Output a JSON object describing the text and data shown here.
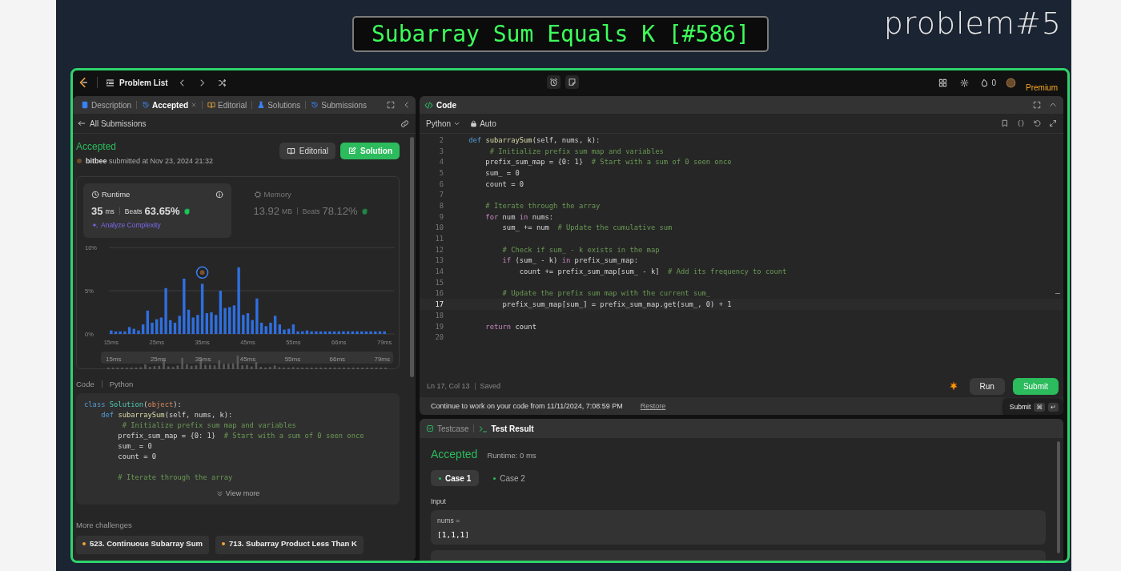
{
  "banner": {
    "title": "Subarray Sum Equals K [#586]",
    "label": "problem#5"
  },
  "topbar": {
    "problem_list": "Problem List",
    "streak": "0",
    "premium": "Premium"
  },
  "left": {
    "tabs": [
      {
        "label": "Description",
        "selected": false,
        "closable": false
      },
      {
        "label": "Accepted",
        "selected": true,
        "closable": true
      },
      {
        "label": "Editorial",
        "selected": false,
        "closable": false
      },
      {
        "label": "Solutions",
        "selected": false,
        "closable": false
      },
      {
        "label": "Submissions",
        "selected": false,
        "closable": false
      }
    ],
    "back_link": "All Submissions",
    "status": "Accepted",
    "user": "bitbee",
    "submitted": "submitted at Nov 23, 2024 21:32",
    "buttons": [
      {
        "label": "Editorial",
        "kind": "secondary"
      },
      {
        "label": "Solution",
        "kind": "primary"
      }
    ],
    "stats": [
      {
        "title": "Runtime",
        "value": "35",
        "unit": "ms",
        "beats_label": "Beats",
        "beats": "63.65%",
        "selected": true,
        "link": "Analyze Complexity"
      },
      {
        "title": "Memory",
        "value": "13.92",
        "unit": "MB",
        "beats_label": "Beats",
        "beats": "78.12%",
        "selected": false
      }
    ],
    "chart_data": {
      "type": "bar",
      "ylim": [
        0,
        10
      ],
      "yticks": [
        {
          "value": 0,
          "label": "0%"
        },
        {
          "value": 5,
          "label": "5%"
        },
        {
          "value": 10,
          "label": "10%"
        }
      ],
      "categories": [
        "15ms",
        null,
        null,
        null,
        null,
        null,
        null,
        null,
        null,
        null,
        "25ms",
        null,
        null,
        null,
        null,
        null,
        null,
        null,
        null,
        null,
        "35ms",
        null,
        null,
        null,
        null,
        null,
        null,
        null,
        null,
        null,
        "45ms",
        null,
        null,
        null,
        null,
        null,
        null,
        null,
        null,
        null,
        "55ms",
        null,
        null,
        null,
        null,
        null,
        null,
        null,
        null,
        null,
        "66ms",
        null,
        null,
        null,
        null,
        null,
        null,
        null,
        null,
        null,
        "79ms"
      ],
      "values": [
        0.4,
        0.3,
        0.3,
        0.3,
        0.8,
        0.6,
        0.4,
        1.1,
        2.7,
        1.3,
        1.7,
        1.9,
        5.3,
        1.6,
        1.3,
        2.1,
        6.4,
        2.8,
        1.9,
        2.2,
        5.8,
        2.4,
        2.5,
        2.2,
        5.0,
        3.0,
        3.1,
        3.3,
        7.7,
        2.2,
        2.4,
        1.6,
        4.1,
        1.3,
        0.9,
        1.3,
        2.1,
        1.1,
        0.5,
        0.6,
        1.1,
        0.3,
        0.3,
        0.4,
        0.3,
        0.3,
        0.3,
        0.3,
        0.3,
        0.3,
        0.3,
        0.3,
        0.3,
        0.3,
        0.3,
        0.3,
        0.3,
        0.3,
        0.3,
        0.3,
        0.3
      ],
      "annotations": [
        {
          "x": "35ms"
        }
      ]
    },
    "overview_labels": [
      "15ms",
      "25ms",
      "35ms",
      "45ms",
      "55ms",
      "66ms",
      "79ms"
    ],
    "code_label": "Code",
    "code_language": "Python",
    "code_lines": [
      {
        "kind": "code",
        "segs": [
          {
            "kind": "kw",
            "text": "class "
          },
          {
            "kind": "cls",
            "text": "Solution"
          },
          {
            "kind": "p",
            "text": "("
          },
          {
            "kind": "bi",
            "text": "object"
          },
          {
            "kind": "p",
            "text": "):"
          }
        ]
      },
      {
        "kind": "code",
        "segs": [
          {
            "kind": "kw",
            "text": "    def "
          },
          {
            "kind": "fn",
            "text": "subarraySum"
          },
          {
            "kind": "p",
            "text": "(self, nums, k):"
          }
        ]
      },
      {
        "kind": "code",
        "segs": [
          {
            "kind": "cm",
            "text": "         # Initialize prefix sum map and variables"
          }
        ]
      },
      {
        "kind": "code",
        "segs": [
          {
            "kind": "p",
            "text": "        prefix_sum_map = {0: 1}  "
          },
          {
            "kind": "cm",
            "text": "# Start with a sum of 0 seen once"
          }
        ]
      },
      {
        "kind": "code",
        "segs": [
          {
            "kind": "p",
            "text": "        sum_ = 0"
          }
        ]
      },
      {
        "kind": "code",
        "segs": [
          {
            "kind": "p",
            "text": "        count = 0"
          }
        ]
      },
      {
        "kind": "blank"
      },
      {
        "kind": "code",
        "segs": [
          {
            "kind": "cm",
            "text": "        # Iterate through the array"
          }
        ]
      }
    ],
    "view_more": "View more",
    "more_title": "More challenges",
    "challenges": [
      {
        "label": "523. Continuous Subarray Sum",
        "color": "#f2a33a"
      },
      {
        "label": "713. Subarray Product Less Than K",
        "color": "#f2a33a"
      }
    ]
  },
  "editor": {
    "title": "Code",
    "language": "Python",
    "mode": "Auto",
    "lines": [
      {
        "n": "2",
        "current": false,
        "segs": [
          {
            "kind": "kw",
            "text": "    def "
          },
          {
            "kind": "fn",
            "text": "subarraySum"
          },
          {
            "kind": "p",
            "text": "(self, nums, k):"
          }
        ]
      },
      {
        "n": "3",
        "current": false,
        "segs": [
          {
            "kind": "cm",
            "text": "         # Initialize prefix sum map and variables"
          }
        ]
      },
      {
        "n": "4",
        "current": false,
        "segs": [
          {
            "kind": "p",
            "text": "        prefix_sum_map = {0: 1}  "
          },
          {
            "kind": "cm",
            "text": "# Start with a sum of 0 seen once"
          }
        ]
      },
      {
        "n": "5",
        "current": false,
        "segs": [
          {
            "kind": "p",
            "text": "        sum_ = 0"
          }
        ]
      },
      {
        "n": "6",
        "current": false,
        "segs": [
          {
            "kind": "p",
            "text": "        count = 0"
          }
        ]
      },
      {
        "n": "7",
        "current": false
      },
      {
        "n": "8",
        "current": false,
        "segs": [
          {
            "kind": "cm",
            "text": "        # Iterate through the array"
          }
        ]
      },
      {
        "n": "9",
        "current": false,
        "segs": [
          {
            "kind": "ctl",
            "text": "        for"
          },
          {
            "kind": "p",
            "text": " num "
          },
          {
            "kind": "ctl",
            "text": "in"
          },
          {
            "kind": "p",
            "text": " nums:"
          }
        ]
      },
      {
        "n": "10",
        "current": false,
        "segs": [
          {
            "kind": "p",
            "text": "            sum_ += num  "
          },
          {
            "kind": "cm",
            "text": "# Update the cumulative sum"
          }
        ]
      },
      {
        "n": "11",
        "current": false
      },
      {
        "n": "12",
        "current": false,
        "segs": [
          {
            "kind": "cm",
            "text": "            # Check if sum_ - k exists in the map"
          }
        ]
      },
      {
        "n": "13",
        "current": false,
        "segs": [
          {
            "kind": "ctl",
            "text": "            if"
          },
          {
            "kind": "p",
            "text": " (sum_ - k) "
          },
          {
            "kind": "ctl",
            "text": "in"
          },
          {
            "kind": "p",
            "text": " prefix_sum_map:"
          }
        ]
      },
      {
        "n": "14",
        "current": false,
        "segs": [
          {
            "kind": "p",
            "text": "                count += prefix_sum_map[sum_ - k]  "
          },
          {
            "kind": "cm",
            "text": "# Add its frequency to count"
          }
        ]
      },
      {
        "n": "15",
        "current": false
      },
      {
        "n": "16",
        "current": false,
        "segs": [
          {
            "kind": "cm",
            "text": "            # Update the prefix sum map with the current sum_"
          }
        ]
      },
      {
        "n": "17",
        "current": true,
        "segs": [
          {
            "kind": "p",
            "text": "            prefix_sum_map[sum_] = prefix_sum_map.get(sum_, 0) + 1"
          }
        ]
      },
      {
        "n": "18",
        "current": false
      },
      {
        "n": "19",
        "current": false,
        "segs": [
          {
            "kind": "ctl",
            "text": "        return"
          },
          {
            "kind": "p",
            "text": " count"
          }
        ]
      },
      {
        "n": "20",
        "current": false
      }
    ],
    "position": "Ln 17, Col 13",
    "saved": "Saved",
    "buttons": [
      {
        "label": "Run",
        "kind": "secondary"
      },
      {
        "label": "Submit",
        "kind": "primary"
      }
    ],
    "tooltip": {
      "label": "Submit",
      "keys": [
        "⌘",
        "↵"
      ]
    },
    "restore": {
      "message": "Continue to work on your code from 11/11/2024, 7:08:59 PM",
      "link": "Restore"
    }
  },
  "result": {
    "tabs": [
      {
        "label": "Testcase",
        "selected": false
      },
      {
        "label": "Test Result",
        "selected": true
      }
    ],
    "status": "Accepted",
    "runtime": "Runtime: 0 ms",
    "cases": [
      {
        "label": "Case 1",
        "selected": true
      },
      {
        "label": "Case 2",
        "selected": false
      }
    ],
    "input_label": "Input",
    "inputs": [
      {
        "name": "nums =",
        "value": "[1,1,1]"
      }
    ]
  }
}
